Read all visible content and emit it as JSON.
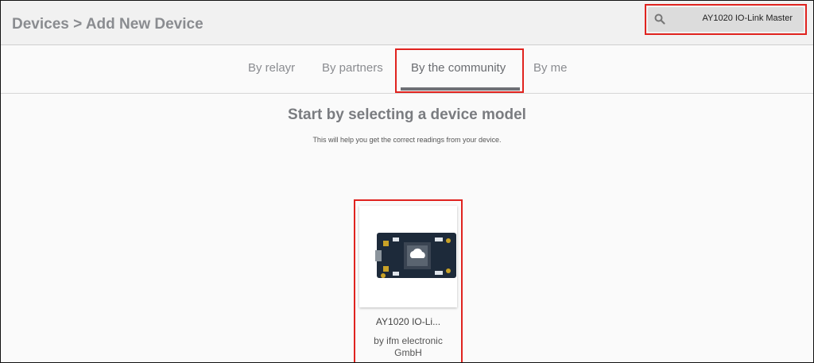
{
  "header": {
    "breadcrumb_parent": "Devices",
    "breadcrumb_sep": ">",
    "breadcrumb_current": "Add New Device",
    "search_value": "AY1020 IO-Link Master",
    "search_icon": "search-icon"
  },
  "tabs": [
    {
      "label": "By relayr",
      "active": false
    },
    {
      "label": "By partners",
      "active": false
    },
    {
      "label": "By the community",
      "active": true
    },
    {
      "label": "By me",
      "active": false
    }
  ],
  "main": {
    "title": "Start by selecting a device model",
    "subtitle": "This will help you get the correct readings from your device."
  },
  "device_card": {
    "name": "AY1020 IO-Li...",
    "by_line1": "by ifm electronic",
    "by_line2": "GmbH",
    "image_icon": "iot-board-icon"
  },
  "colors": {
    "highlight": "#e0231f",
    "header_bg": "#f1f1f1",
    "text_gray": "#8a8c90"
  }
}
